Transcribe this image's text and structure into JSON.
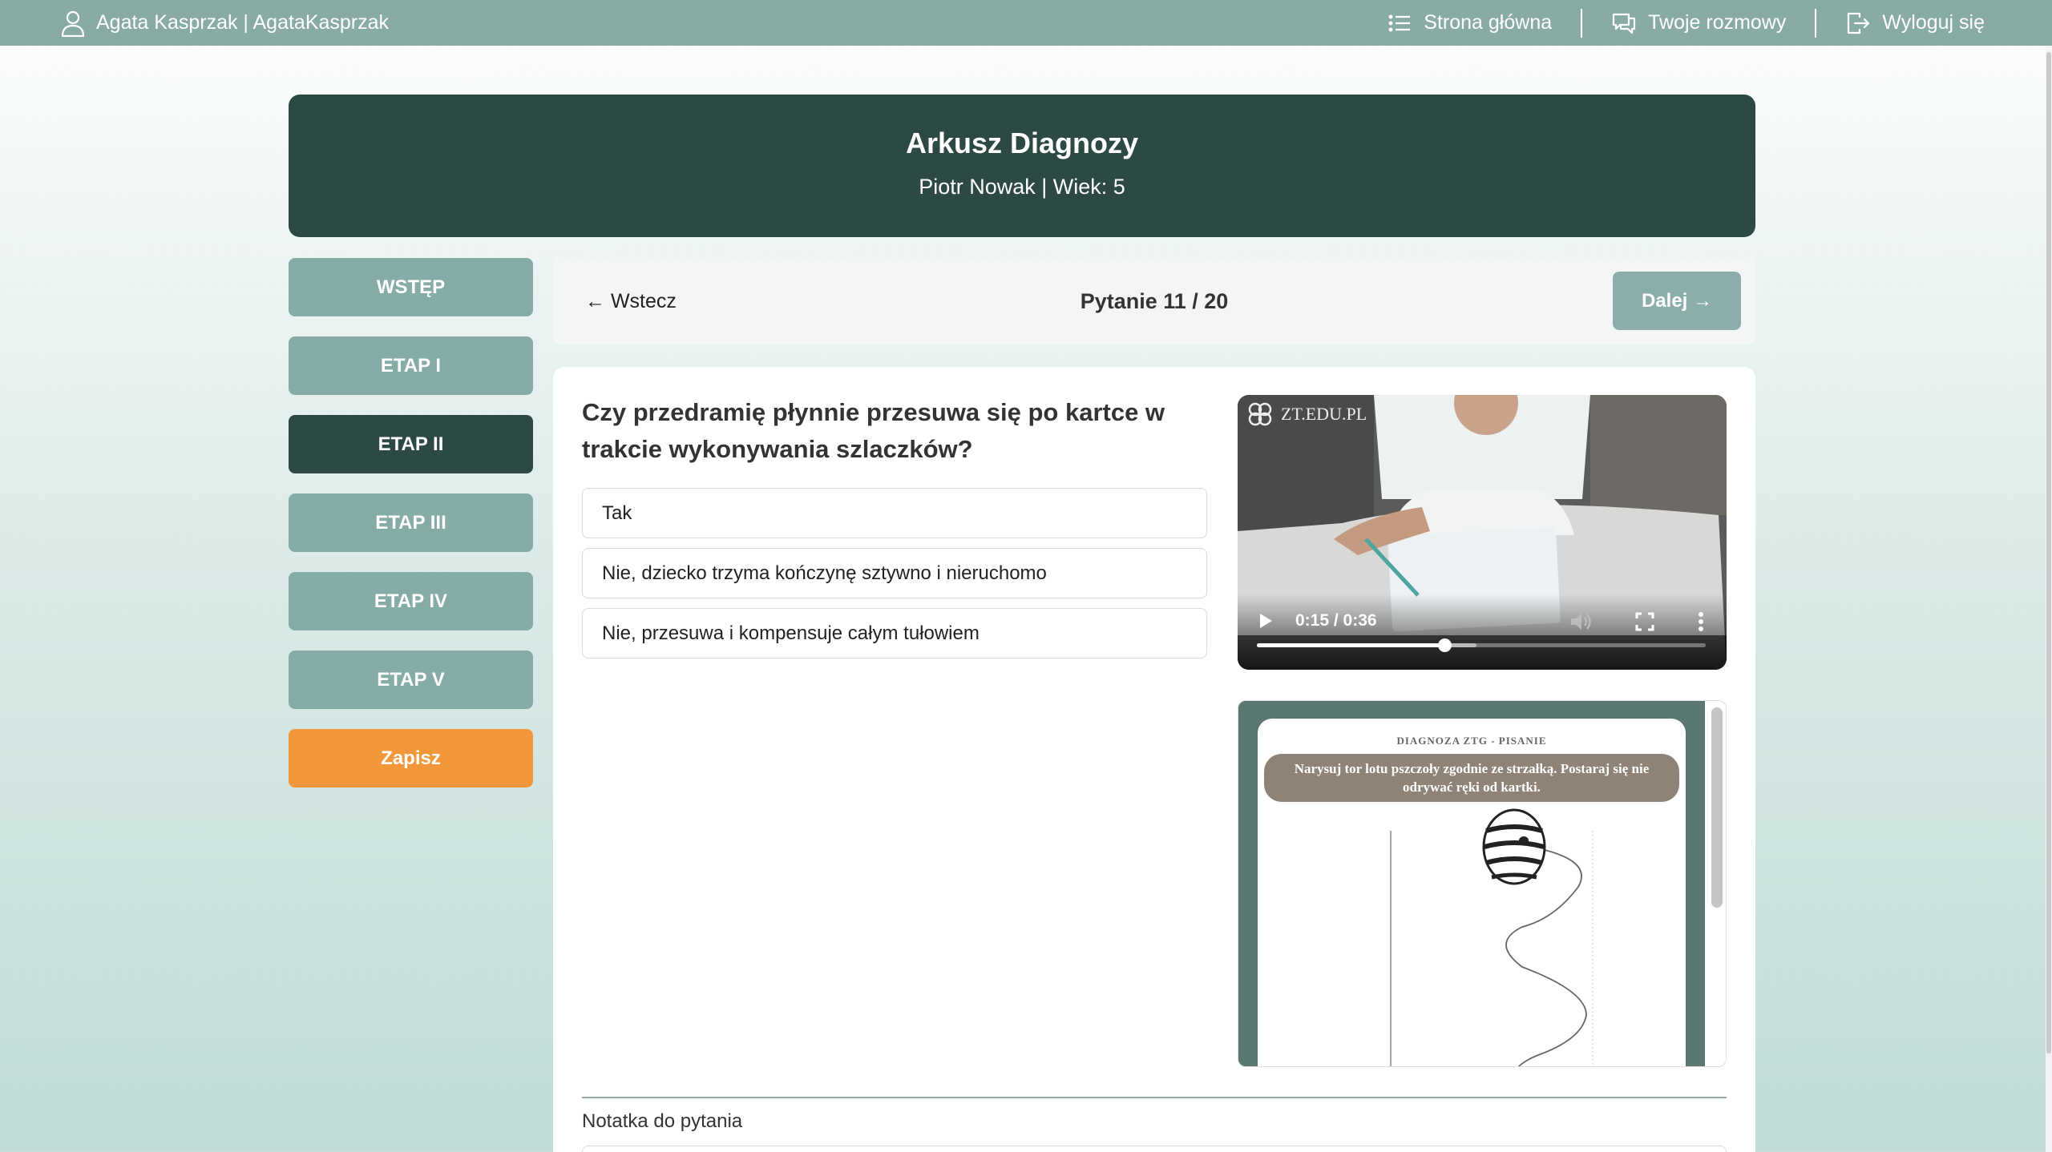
{
  "topbar": {
    "user_label": "Agata Kasprzak | AgataKasprzak",
    "nav": [
      {
        "label": "Strona główna",
        "icon": "list-icon"
      },
      {
        "label": "Twoje rozmowy",
        "icon": "chat-icon"
      },
      {
        "label": "Wyloguj się",
        "icon": "logout-icon"
      }
    ]
  },
  "header": {
    "title": "Arkusz Diagnozy",
    "subtitle": "Piotr Nowak | Wiek: 5"
  },
  "sidebar": {
    "items": [
      {
        "label": "WSTĘP",
        "active": false
      },
      {
        "label": "ETAP I",
        "active": false
      },
      {
        "label": "ETAP II",
        "active": true
      },
      {
        "label": "ETAP III",
        "active": false
      },
      {
        "label": "ETAP IV",
        "active": false
      },
      {
        "label": "ETAP V",
        "active": false
      }
    ],
    "save_label": "Zapisz"
  },
  "question_nav": {
    "back_label": "← Wstecz",
    "counter": "Pytanie 11 / 20",
    "next_label": "Dalej →"
  },
  "question": {
    "text": "Czy przedramię płynnie przesuwa się po kartce w trakcie wykonywania szlaczków?",
    "answers": [
      "Tak",
      "Nie, dziecko trzyma kończynę sztywno i nieruchomo",
      "Nie, przesuwa i kompensuje całym tułowiem"
    ]
  },
  "video": {
    "watermark": "ZT.EDU.PL",
    "time": "0:15 / 0:36",
    "played_fraction": 0.417,
    "buffered_fraction": 0.49
  },
  "worksheet": {
    "title": "DIAGNOZA ZTG - PISANIE",
    "instruction": "Narysuj tor lotu pszczoły zgodnie ze strzałką. Postaraj się nie odrywać ręki od kartki."
  },
  "note": {
    "label": "Notatka do pytania"
  },
  "colors": {
    "topbar": "#88aba6",
    "dark_teal": "#2d4944",
    "sidebar_button": "#86aca7",
    "save_button": "#f2973a"
  }
}
